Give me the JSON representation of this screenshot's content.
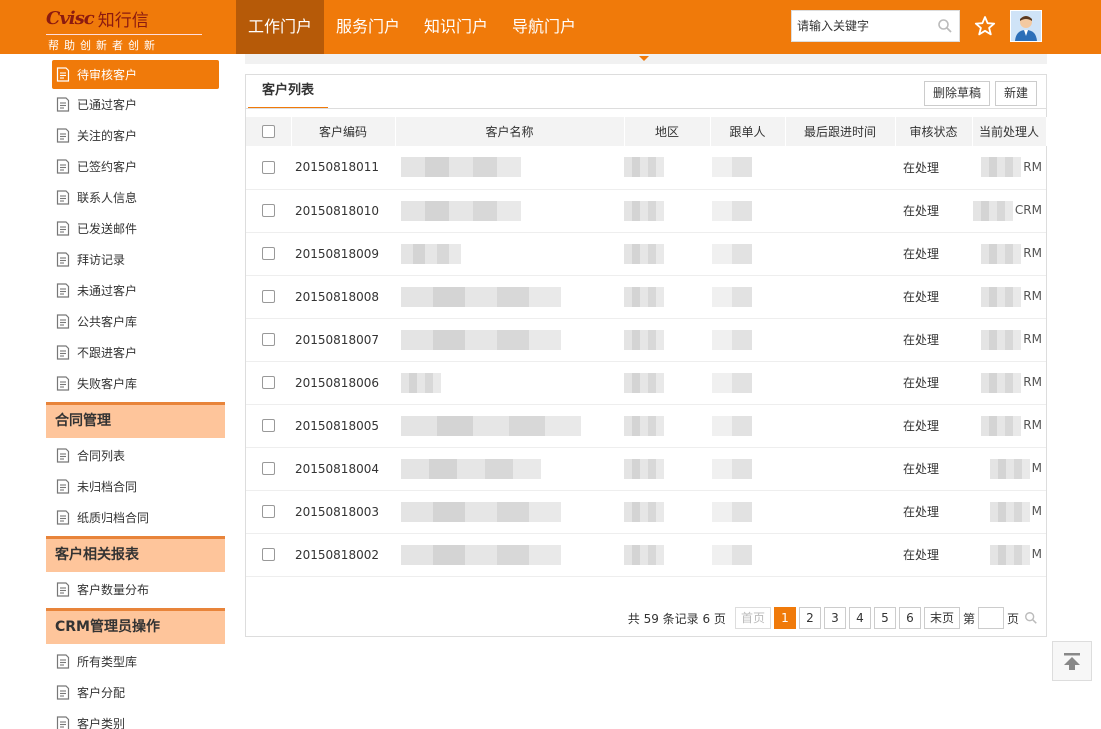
{
  "header": {
    "logo_mark": "Cvisc",
    "logo_cn": "知行信",
    "logo_sub": "帮助创新者创新",
    "nav": [
      "工作门户",
      "服务门户",
      "知识门户",
      "导航门户"
    ],
    "search_placeholder": "请输入关键字",
    "accent": "#f07a0a"
  },
  "sidebar": {
    "groups": [
      {
        "title": "",
        "items": [
          "待审核客户",
          "已通过客户",
          "关注的客户",
          "已签约客户",
          "联系人信息",
          "已发送邮件",
          "拜访记录",
          "未通过客户",
          "公共客户库",
          "不跟进客户",
          "失败客户库"
        ]
      },
      {
        "title": "合同管理",
        "items": [
          "合同列表",
          "未归档合同",
          "纸质归档合同"
        ]
      },
      {
        "title": "客户相关报表",
        "items": [
          "客户数量分布"
        ]
      },
      {
        "title": "CRM管理员操作",
        "items": [
          "所有类型库",
          "客户分配",
          "客户类别"
        ]
      }
    ]
  },
  "panel": {
    "title": "客户列表",
    "delete_draft": "删除草稿",
    "new": "新建",
    "columns": [
      "客户编码",
      "客户名称",
      "地区",
      "跟单人",
      "最后跟进时间",
      "审核状态",
      "当前处理人"
    ],
    "rows": [
      {
        "code": "20150818011",
        "status": "在处理",
        "owner_suffix": "RM"
      },
      {
        "code": "20150818010",
        "status": "在处理",
        "owner_suffix": "CRM"
      },
      {
        "code": "20150818009",
        "status": "在处理",
        "owner_suffix": "RM"
      },
      {
        "code": "20150818008",
        "status": "在处理",
        "owner_suffix": "RM"
      },
      {
        "code": "20150818007",
        "status": "在处理",
        "owner_suffix": "RM"
      },
      {
        "code": "20150818006",
        "status": "在处理",
        "owner_suffix": "RM"
      },
      {
        "code": "20150818005",
        "status": "在处理",
        "owner_suffix": "RM"
      },
      {
        "code": "20150818004",
        "status": "在处理",
        "owner_suffix": "M"
      },
      {
        "code": "20150818003",
        "status": "在处理",
        "owner_suffix": "M"
      },
      {
        "code": "20150818002",
        "status": "在处理",
        "owner_suffix": "M"
      }
    ]
  },
  "pager": {
    "info": "共 59 条记录 6 页",
    "first": "首页",
    "pages": [
      "1",
      "2",
      "3",
      "4",
      "5",
      "6"
    ],
    "current": "1",
    "last": "末页",
    "jump_prefix": "第",
    "jump_suffix": "页"
  }
}
